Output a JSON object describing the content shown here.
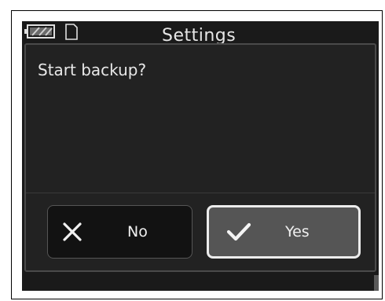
{
  "screen": {
    "title": "Settings"
  },
  "status_icons": [
    "battery-icon",
    "memory-card-icon"
  ],
  "dialog": {
    "message": "Start backup?",
    "no_label": "No",
    "yes_label": "Yes",
    "no_icon": "close-icon",
    "yes_icon": "checkmark-icon",
    "selected": "yes"
  },
  "colors": {
    "background": "#1a1a1a",
    "dialog": "#222222",
    "selected_button": "#555555",
    "text": "#f0f0f0"
  }
}
